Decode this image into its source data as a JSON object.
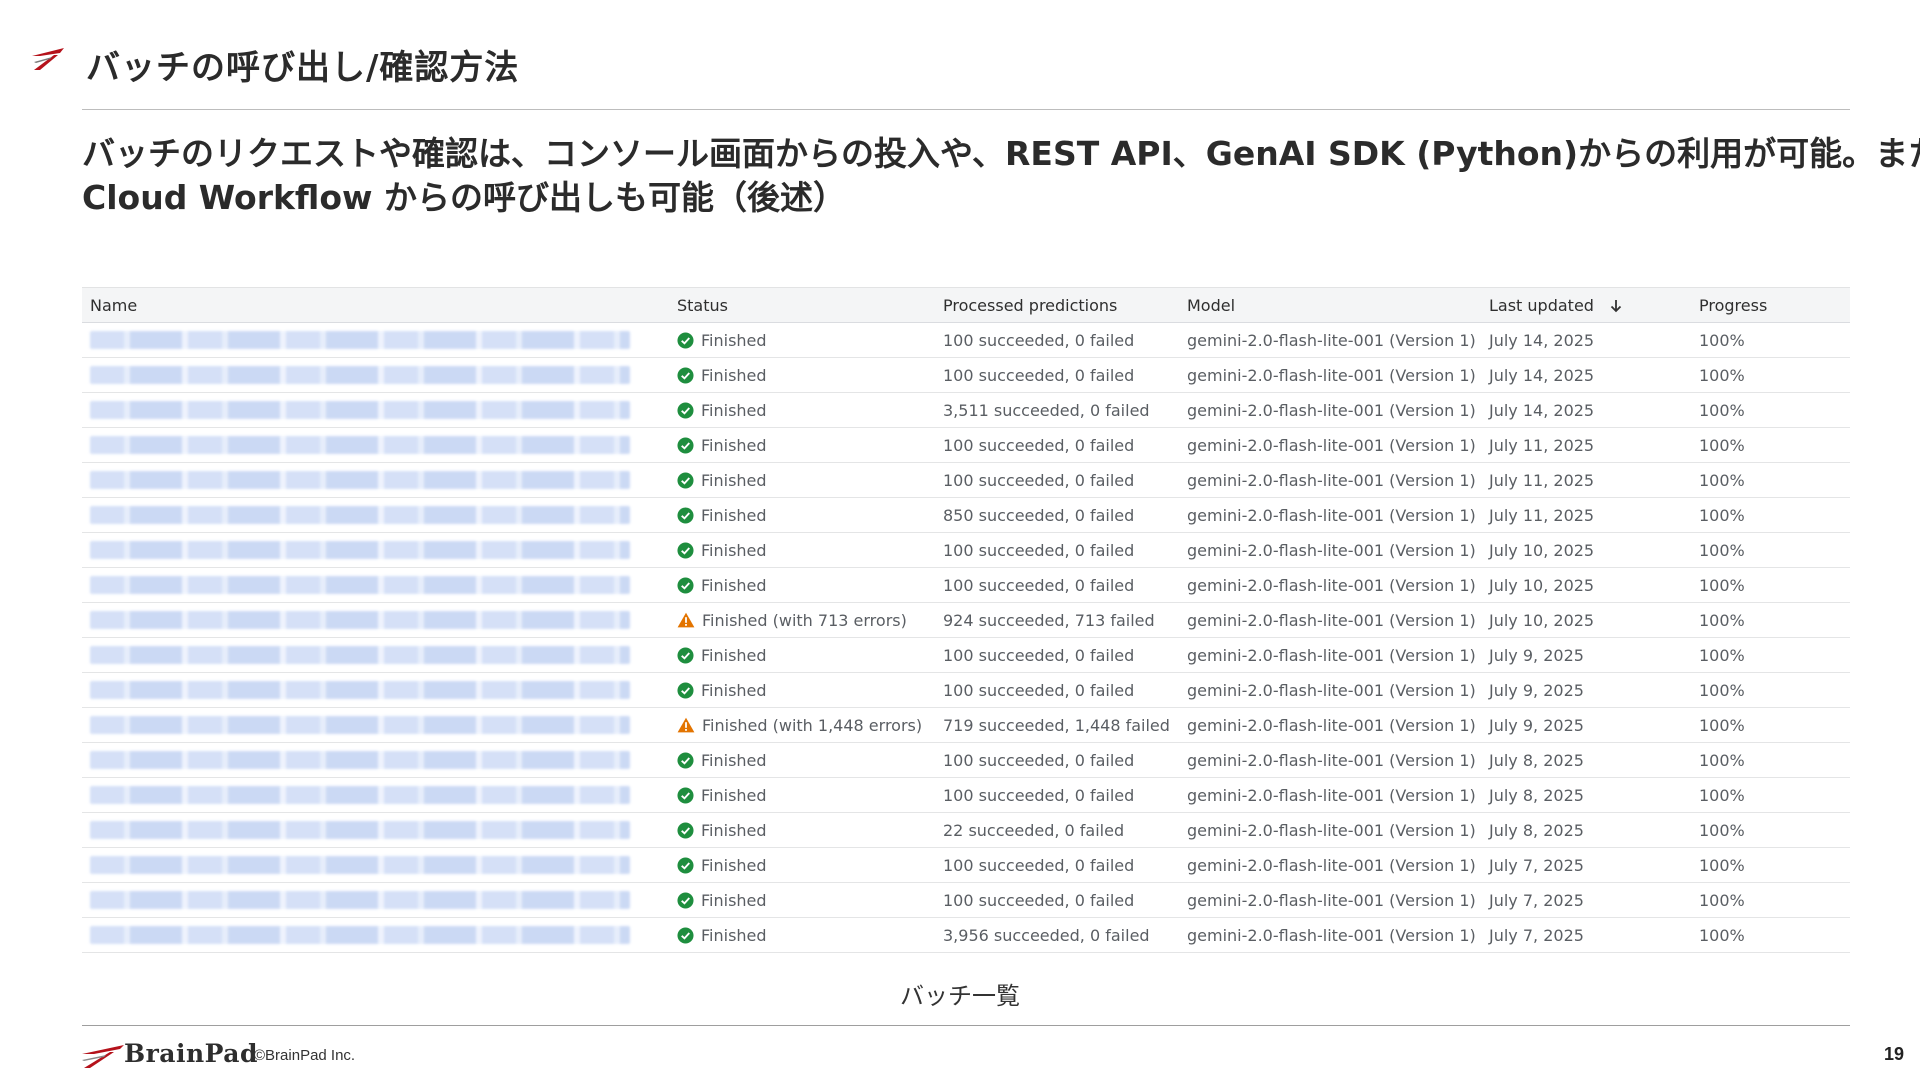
{
  "slide": {
    "title": "バッチの呼び出し/確認方法",
    "lead_line1": "バッチのリクエストや確認は、コンソール画面からの投入や、REST API、GenAI SDK (Python)からの利用が可能。また、",
    "lead_line2": "Cloud Workflow からの呼び出しも可能（後述）",
    "caption": "バッチ一覧",
    "copyright": "©BrainPad Inc.",
    "page_number": "19",
    "brand": "BrainPad",
    "accent_color": "#b5121b"
  },
  "table": {
    "columns": {
      "name": "Name",
      "status": "Status",
      "processed": "Processed predictions",
      "model": "Model",
      "last_updated": "Last updated",
      "progress": "Progress"
    },
    "rows": [
      {
        "status_icon": "check-circle-icon",
        "status": "Finished",
        "processed": "100 succeeded, 0 failed",
        "model": "gemini-2.0-flash-lite-001 (Version 1)",
        "last_updated": "July 14, 2025",
        "progress": "100%"
      },
      {
        "status_icon": "check-circle-icon",
        "status": "Finished",
        "processed": "100 succeeded, 0 failed",
        "model": "gemini-2.0-flash-lite-001 (Version 1)",
        "last_updated": "July 14, 2025",
        "progress": "100%"
      },
      {
        "status_icon": "check-circle-icon",
        "status": "Finished",
        "processed": "3,511 succeeded, 0 failed",
        "model": "gemini-2.0-flash-lite-001 (Version 1)",
        "last_updated": "July 14, 2025",
        "progress": "100%"
      },
      {
        "status_icon": "check-circle-icon",
        "status": "Finished",
        "processed": "100 succeeded, 0 failed",
        "model": "gemini-2.0-flash-lite-001 (Version 1)",
        "last_updated": "July 11, 2025",
        "progress": "100%"
      },
      {
        "status_icon": "check-circle-icon",
        "status": "Finished",
        "processed": "100 succeeded, 0 failed",
        "model": "gemini-2.0-flash-lite-001 (Version 1)",
        "last_updated": "July 11, 2025",
        "progress": "100%"
      },
      {
        "status_icon": "check-circle-icon",
        "status": "Finished",
        "processed": "850 succeeded, 0 failed",
        "model": "gemini-2.0-flash-lite-001 (Version 1)",
        "last_updated": "July 11, 2025",
        "progress": "100%"
      },
      {
        "status_icon": "check-circle-icon",
        "status": "Finished",
        "processed": "100 succeeded, 0 failed",
        "model": "gemini-2.0-flash-lite-001 (Version 1)",
        "last_updated": "July 10, 2025",
        "progress": "100%"
      },
      {
        "status_icon": "check-circle-icon",
        "status": "Finished",
        "processed": "100 succeeded, 0 failed",
        "model": "gemini-2.0-flash-lite-001 (Version 1)",
        "last_updated": "July 10, 2025",
        "progress": "100%"
      },
      {
        "status_icon": "warning-triangle-icon",
        "status": "Finished (with 713 errors)",
        "processed": "924 succeeded, 713 failed",
        "model": "gemini-2.0-flash-lite-001 (Version 1)",
        "last_updated": "July 10, 2025",
        "progress": "100%"
      },
      {
        "status_icon": "check-circle-icon",
        "status": "Finished",
        "processed": "100 succeeded, 0 failed",
        "model": "gemini-2.0-flash-lite-001 (Version 1)",
        "last_updated": "July 9, 2025",
        "progress": "100%"
      },
      {
        "status_icon": "check-circle-icon",
        "status": "Finished",
        "processed": "100 succeeded, 0 failed",
        "model": "gemini-2.0-flash-lite-001 (Version 1)",
        "last_updated": "July 9, 2025",
        "progress": "100%"
      },
      {
        "status_icon": "warning-triangle-icon",
        "status": "Finished (with 1,448 errors)",
        "processed": "719 succeeded, 1,448 failed",
        "model": "gemini-2.0-flash-lite-001 (Version 1)",
        "last_updated": "July 9, 2025",
        "progress": "100%"
      },
      {
        "status_icon": "check-circle-icon",
        "status": "Finished",
        "processed": "100 succeeded, 0 failed",
        "model": "gemini-2.0-flash-lite-001 (Version 1)",
        "last_updated": "July 8, 2025",
        "progress": "100%"
      },
      {
        "status_icon": "check-circle-icon",
        "status": "Finished",
        "processed": "100 succeeded, 0 failed",
        "model": "gemini-2.0-flash-lite-001 (Version 1)",
        "last_updated": "July 8, 2025",
        "progress": "100%"
      },
      {
        "status_icon": "check-circle-icon",
        "status": "Finished",
        "processed": "22 succeeded, 0 failed",
        "model": "gemini-2.0-flash-lite-001 (Version 1)",
        "last_updated": "July 8, 2025",
        "progress": "100%"
      },
      {
        "status_icon": "check-circle-icon",
        "status": "Finished",
        "processed": "100 succeeded, 0 failed",
        "model": "gemini-2.0-flash-lite-001 (Version 1)",
        "last_updated": "July 7, 2025",
        "progress": "100%"
      },
      {
        "status_icon": "check-circle-icon",
        "status": "Finished",
        "processed": "100 succeeded, 0 failed",
        "model": "gemini-2.0-flash-lite-001 (Version 1)",
        "last_updated": "July 7, 2025",
        "progress": "100%"
      },
      {
        "status_icon": "check-circle-icon",
        "status": "Finished",
        "processed": "3,956 succeeded, 0 failed",
        "model": "gemini-2.0-flash-lite-001 (Version 1)",
        "last_updated": "July 7, 2025",
        "progress": "100%"
      }
    ]
  },
  "colors": {
    "success": "#1e8e3e",
    "warning": "#e37400",
    "header_bg": "#f4f5f6"
  }
}
